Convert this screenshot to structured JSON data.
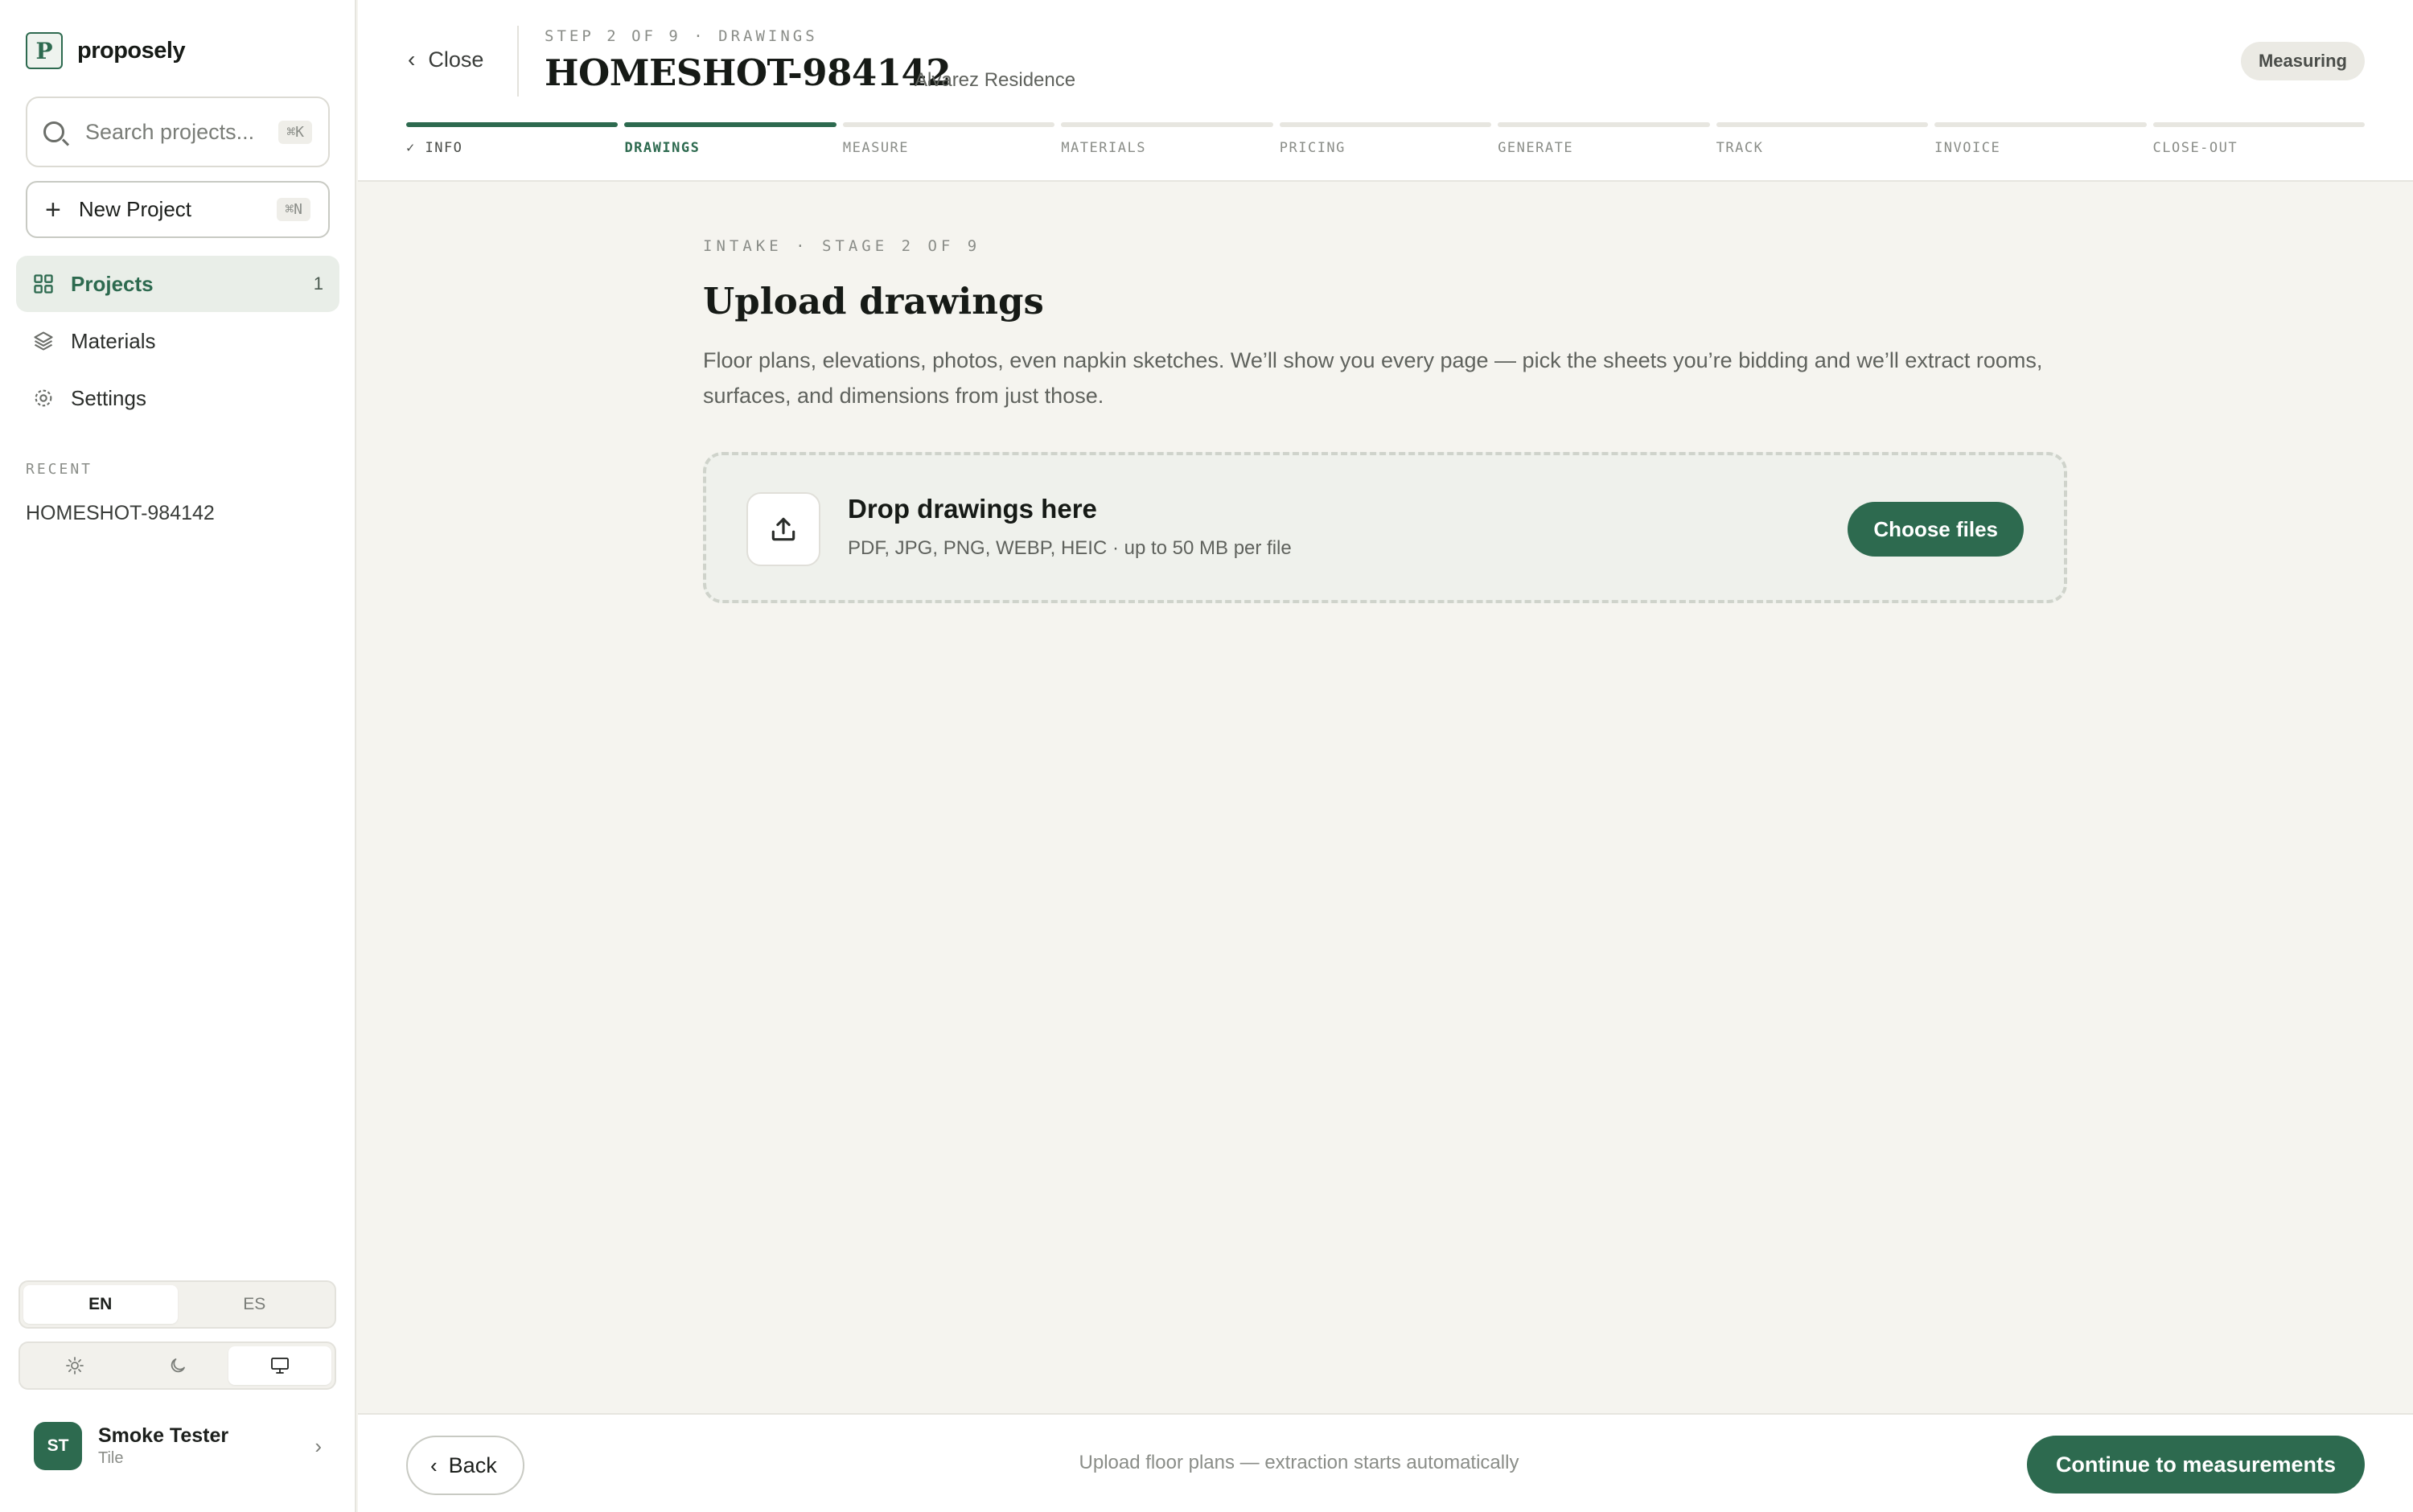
{
  "brand": {
    "name": "proposely",
    "logo_letter": "P"
  },
  "search": {
    "placeholder": "Search projects...",
    "shortcut": "⌘K"
  },
  "new_project": {
    "label": "New Project",
    "shortcut": "⌘N"
  },
  "nav": [
    {
      "label": "Projects",
      "count": "1",
      "icon": "grid-icon",
      "active": true
    },
    {
      "label": "Materials",
      "icon": "layers-icon"
    },
    {
      "label": "Settings",
      "icon": "gear-icon"
    }
  ],
  "recent": {
    "heading": "RECENT",
    "items": [
      "HOMESHOT-984142"
    ]
  },
  "language": {
    "options": [
      "EN",
      "ES"
    ],
    "selected": "EN"
  },
  "theme": {
    "options": [
      "sun-icon",
      "moon-icon",
      "monitor-icon"
    ],
    "selected": "monitor-icon"
  },
  "user": {
    "initials": "ST",
    "name": "Smoke Tester",
    "role": "Tile"
  },
  "header": {
    "close_label": "Close",
    "step_label": "STEP 2 OF 9 · DRAWINGS",
    "project_title": "HOMESHOT-984142",
    "project_subtitle": "Alvarez Residence",
    "status": "Measuring"
  },
  "steps": [
    {
      "label": "✓ INFO",
      "state": "done"
    },
    {
      "label": "DRAWINGS",
      "state": "current"
    },
    {
      "label": "MEASURE",
      "state": "todo"
    },
    {
      "label": "MATERIALS",
      "state": "todo"
    },
    {
      "label": "PRICING",
      "state": "todo"
    },
    {
      "label": "GENERATE",
      "state": "todo"
    },
    {
      "label": "TRACK",
      "state": "todo"
    },
    {
      "label": "INVOICE",
      "state": "todo"
    },
    {
      "label": "CLOSE-OUT",
      "state": "todo"
    }
  ],
  "main": {
    "stage_label": "INTAKE · STAGE 2 OF 9",
    "title": "Upload drawings",
    "description": "Floor plans, elevations, photos, even napkin sketches. We’ll show you every page — pick the sheets you’re bidding and we’ll extract rooms, surfaces, and dimensions from just those.",
    "dropzone": {
      "title": "Drop drawings here",
      "hint": "PDF, JPG, PNG, WEBP, HEIC · up to 50 MB per file",
      "button": "Choose files"
    }
  },
  "footer": {
    "back_label": "Back",
    "hint": "Upload floor plans — extraction starts automatically",
    "continue_label": "Continue to measurements"
  },
  "colors": {
    "accent": "#2d6a4f",
    "background": "#f5f4ef",
    "surface": "#ffffff"
  }
}
